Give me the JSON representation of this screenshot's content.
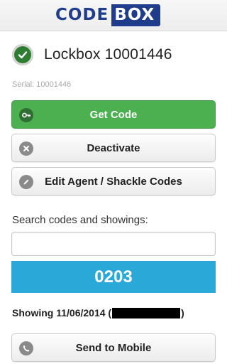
{
  "header": {
    "logo_part1": "CODE",
    "logo_part2": "BOX"
  },
  "lockbox": {
    "title": "Lockbox 10001446",
    "serial": "Serial: 10001446",
    "status_icon": "check-circle-icon"
  },
  "actions": {
    "get_code": {
      "label": "Get Code",
      "icon": "key-icon"
    },
    "deactivate": {
      "label": "Deactivate",
      "icon": "x-circle-icon"
    },
    "edit_codes": {
      "label": "Edit Agent / Shackle Codes",
      "icon": "pencil-icon"
    }
  },
  "search": {
    "label": "Search codes and showings:",
    "value": "",
    "placeholder": ""
  },
  "code_display": {
    "value": "0203"
  },
  "showing": {
    "prefix": "Showing 11/06/2014 (",
    "suffix": ")"
  },
  "send_to_mobile": {
    "label": "Send to Mobile",
    "icon": "phone-icon"
  },
  "colors": {
    "brand": "#1f3d8a",
    "primary_green": "#4caf50",
    "code_blue": "#2aa9d8"
  }
}
